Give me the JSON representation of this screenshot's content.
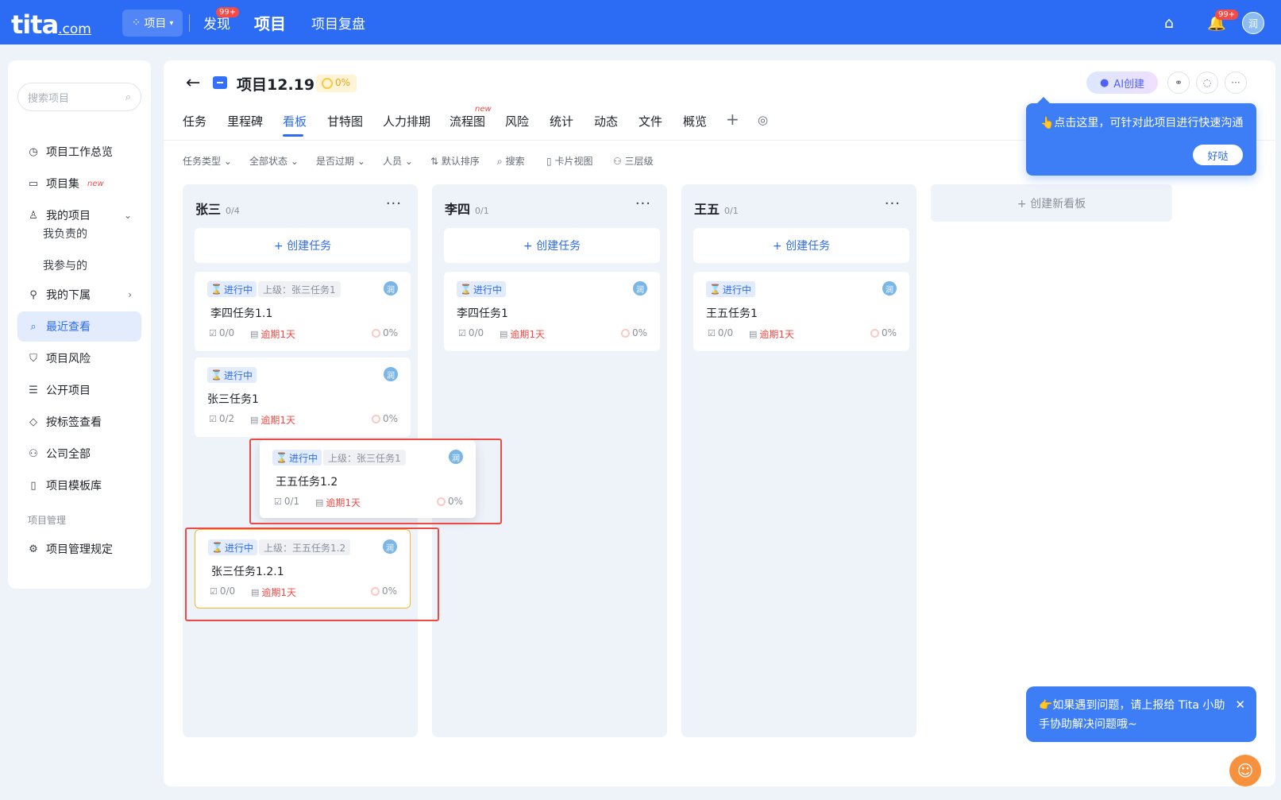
{
  "topbar": {
    "logo_main": "tita",
    "logo_suffix": ".com",
    "switch_label": "项目",
    "nav": [
      {
        "label": "发现",
        "badge": "99+"
      },
      {
        "label": "项目"
      },
      {
        "label": "项目复盘"
      }
    ],
    "bell_badge": "99+",
    "avatar": "润"
  },
  "sidebar": {
    "search_placeholder": "搜索项目",
    "items": {
      "overview": "项目工作总览",
      "collection": "项目集",
      "collection_tag": "new",
      "mine": "我的项目",
      "mine_lead": "我负责的",
      "mine_join": "我参与的",
      "subordinates": "我的下属",
      "recent": "最近查看",
      "risk": "项目风险",
      "public": "公开项目",
      "by_tag": "按标签查看",
      "company": "公司全部",
      "templates": "项目模板库",
      "group_label": "项目管理",
      "rules": "项目管理规定"
    }
  },
  "project": {
    "title": "项目12.19",
    "progress": "0%",
    "ai_label": "AI创建"
  },
  "tabs": [
    {
      "label": "任务"
    },
    {
      "label": "里程碑"
    },
    {
      "label": "看板"
    },
    {
      "label": "甘特图"
    },
    {
      "label": "人力排期"
    },
    {
      "label": "流程图"
    },
    {
      "label": "风险"
    },
    {
      "label": "统计"
    },
    {
      "label": "动态"
    },
    {
      "label": "文件"
    },
    {
      "label": "概览"
    }
  ],
  "tab_new_tag": "new",
  "filters": {
    "type": "任务类型",
    "status": "全部状态",
    "overdue": "是否过期",
    "person": "人员",
    "sort": "默认排序",
    "search": "搜索",
    "view": "卡片视图",
    "level": "三层级"
  },
  "board": {
    "create_task": "+ 创建任务",
    "create_board": "+ 创建新看板",
    "columns": [
      {
        "name": "张三",
        "count": "0/4"
      },
      {
        "name": "李四",
        "count": "0/1"
      },
      {
        "name": "王五",
        "count": "0/1"
      }
    ],
    "cards": {
      "c1": {
        "status": "进行中",
        "parent": "上级：张三任务1",
        "title": "李四任务1.1",
        "checks": "0/0",
        "due": "逾期1天",
        "pct": "0%",
        "avatar": "润"
      },
      "c2": {
        "status": "进行中",
        "title": "张三任务1",
        "checks": "0/2",
        "due": "逾期1天",
        "pct": "0%",
        "avatar": "润"
      },
      "c3": {
        "status": "进行中",
        "parent": "上级：王五任务1.2",
        "title": "张三任务1.2.1",
        "checks": "0/0",
        "due": "逾期1天",
        "pct": "0%",
        "avatar": "润"
      },
      "c4": {
        "status": "进行中",
        "parent": "上级：张三任务1",
        "title": "王五任务1.2",
        "checks": "0/1",
        "due": "逾期1天",
        "pct": "0%",
        "avatar": "润"
      },
      "c5": {
        "status": "进行中",
        "title": "李四任务1",
        "checks": "0/0",
        "due": "逾期1天",
        "pct": "0%",
        "avatar": "润"
      },
      "c6": {
        "status": "进行中",
        "title": "王五任务1",
        "checks": "0/0",
        "due": "逾期1天",
        "pct": "0%",
        "avatar": "润"
      }
    }
  },
  "tooltip": {
    "text": "👆点击这里，可针对此项目进行快速沟通",
    "button": "好哒"
  },
  "help": {
    "text": "👉如果遇到问题，请上报给 Tita 小助手协助解决问题哦~"
  },
  "colors": {
    "brand": "#2c6cf4",
    "overdue": "#f54a45",
    "highlight_border": "#f7b731",
    "annotation_red": "#ee4a45"
  }
}
